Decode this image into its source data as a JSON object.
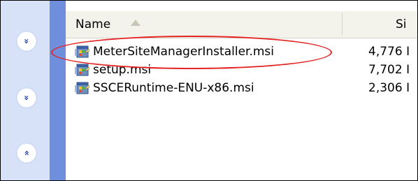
{
  "explorer": {
    "header": {
      "name_label": "Name",
      "size_label": "Si"
    },
    "left_pane": {
      "chevrons": [
        "»",
        "»",
        "»"
      ]
    },
    "files": [
      {
        "name": "MeterSiteManagerInstaller.msi",
        "size": "4,776 I",
        "icon": "msi-package-icon",
        "highlighted": true
      },
      {
        "name": "setup.msi",
        "size": "7,702 I",
        "icon": "msi-package-icon",
        "highlighted": false
      },
      {
        "name": "SSCERuntime-ENU-x86.msi",
        "size": "2,306 I",
        "icon": "msi-package-icon",
        "highlighted": false
      }
    ],
    "annotation_color": "#e52222"
  }
}
